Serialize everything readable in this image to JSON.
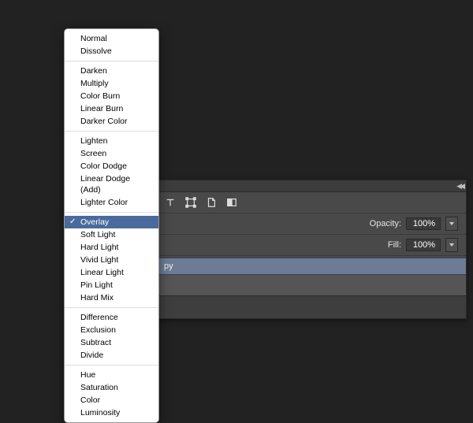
{
  "panel": {
    "opacity_label": "Opacity:",
    "opacity_value": "100%",
    "fill_label": "Fill:",
    "fill_value": "100%",
    "selected_layer": "py"
  },
  "blend_menu": {
    "selected": "Overlay",
    "groups": [
      [
        "Normal",
        "Dissolve"
      ],
      [
        "Darken",
        "Multiply",
        "Color Burn",
        "Linear Burn",
        "Darker Color"
      ],
      [
        "Lighten",
        "Screen",
        "Color Dodge",
        "Linear Dodge (Add)",
        "Lighter Color"
      ],
      [
        "Overlay",
        "Soft Light",
        "Hard Light",
        "Vivid Light",
        "Linear Light",
        "Pin Light",
        "Hard Mix"
      ],
      [
        "Difference",
        "Exclusion",
        "Subtract",
        "Divide"
      ],
      [
        "Hue",
        "Saturation",
        "Color",
        "Luminosity"
      ]
    ]
  }
}
